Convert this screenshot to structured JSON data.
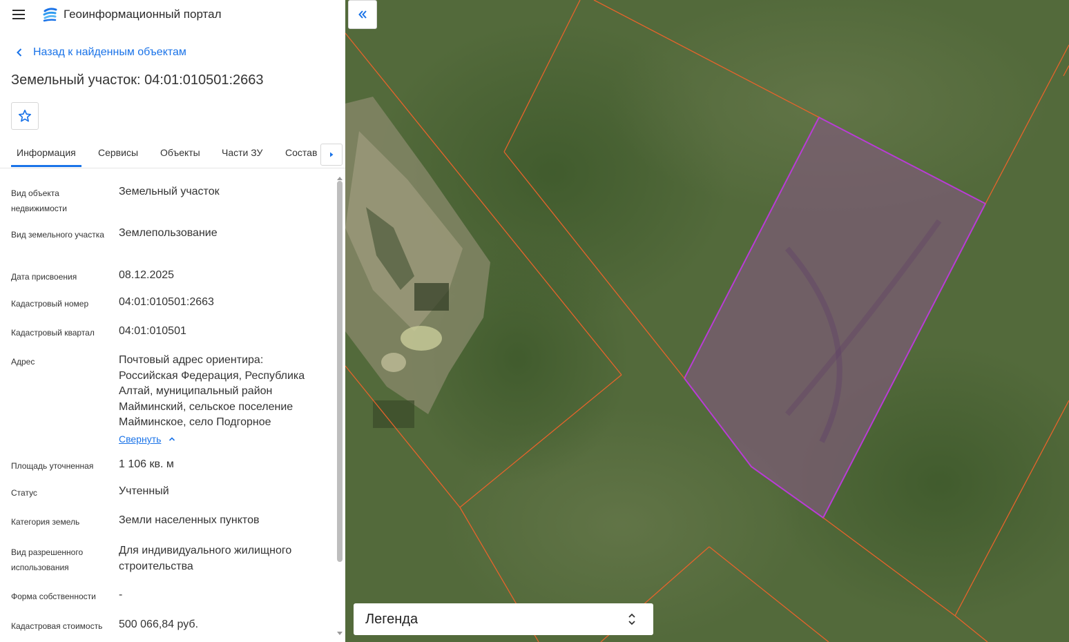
{
  "app": {
    "title": "Геоинформационный портал"
  },
  "nav": {
    "back_label": "Назад к найденным объектам"
  },
  "page": {
    "title": "Земельный участок: 04:01:010501:2663"
  },
  "tabs": [
    {
      "label": "Информация",
      "active": true
    },
    {
      "label": "Сервисы"
    },
    {
      "label": "Объекты"
    },
    {
      "label": "Части ЗУ"
    },
    {
      "label": "Состав"
    }
  ],
  "info": {
    "object_type": {
      "label": "Вид объекта недвижимости",
      "value": "Земельный участок"
    },
    "parcel_type": {
      "label": "Вид земельного участка",
      "value": "Землепользование"
    },
    "assigned_date": {
      "label": "Дата присвоения",
      "value": "08.12.2025"
    },
    "cadastral_number": {
      "label": "Кадастровый номер",
      "value": "04:01:010501:2663"
    },
    "cadastral_block": {
      "label": "Кадастровый квартал",
      "value": "04:01:010501"
    },
    "address": {
      "label": "Адрес",
      "value": "Почтовый адрес ориентира: Российская Федерация, Республика Алтай, муниципальный район Майминский, сельское поселение Майминское, село Подгорное",
      "collapse_label": "Свернуть"
    },
    "area": {
      "label": "Площадь уточненная",
      "value": "1 106 кв. м"
    },
    "status": {
      "label": "Статус",
      "value": "Учтенный"
    },
    "land_category": {
      "label": "Категория земель",
      "value": "Земли населенных пунктов"
    },
    "permitted_use": {
      "label": "Вид разрешенного использования",
      "value": "Для индивидуального жилищного строительства"
    },
    "ownership_form": {
      "label": "Форма собственности",
      "value": "-"
    },
    "cadastral_value": {
      "label": "Кадастровая стоимость",
      "value": "500 066,84 руб."
    }
  },
  "map": {
    "legend_label": "Легенда",
    "colors": {
      "boundary": "#e8632b",
      "selected_parcel": "#b93cd6",
      "accent": "#1a73e8"
    }
  },
  "icons": [
    "menu-icon",
    "portal-logo-icon",
    "chevron-left-icon",
    "star-icon",
    "caret-right-icon",
    "chevron-up-icon",
    "double-chevron-left-icon",
    "sort-updown-icon"
  ]
}
